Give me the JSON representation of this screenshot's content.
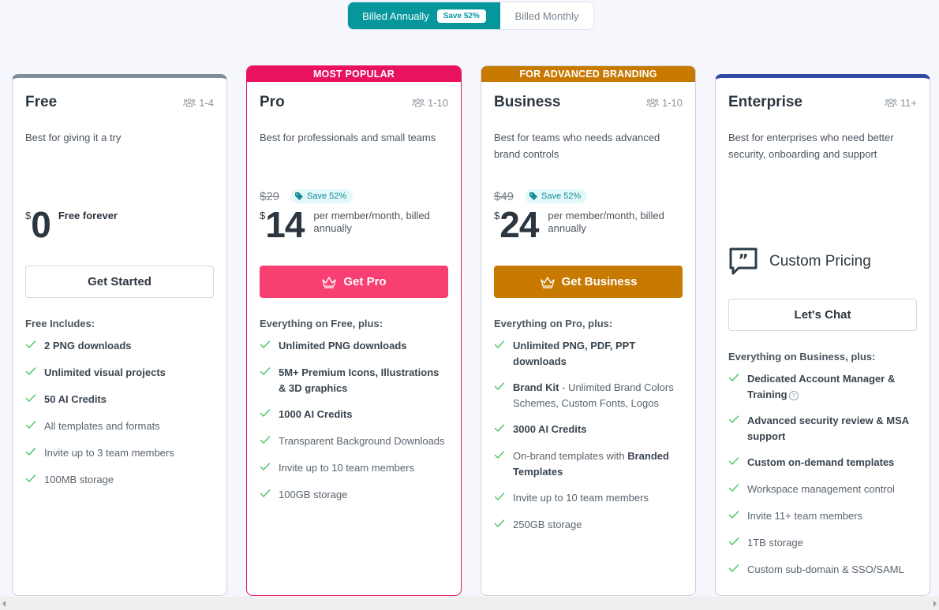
{
  "billing_toggle": {
    "annual_label": "Billed Annually",
    "annual_badge": "Save 52%",
    "monthly_label": "Billed Monthly",
    "active": "annual",
    "accent_color": "#05979c"
  },
  "plans": [
    {
      "name": "Free",
      "seats": "1-4",
      "description": "Best for giving it a try",
      "currency": "$",
      "price": "0",
      "price_note": "Free forever",
      "cta": "Get Started",
      "includes_title": "Free Includes:",
      "top_color": "#7d8f99",
      "features": [
        {
          "text": "2 PNG downloads",
          "bold": true
        },
        {
          "text": "Unlimited visual projects",
          "bold": true
        },
        {
          "text": "50 AI Credits",
          "bold": true
        },
        {
          "text": "All templates and formats",
          "bold": false
        },
        {
          "text": "Invite up to 3 team members",
          "bold": false
        },
        {
          "text": "100MB storage",
          "bold": false
        }
      ]
    },
    {
      "name": "Pro",
      "banner": "MOST POPULAR",
      "banner_color": "#e8125f",
      "seats": "1-10",
      "description": "Best for professionals and small teams",
      "old_price": "$29",
      "save_badge": "Save 52%",
      "currency": "$",
      "price": "14",
      "price_note": "per member/month, billed annually",
      "cta": "Get Pro",
      "cta_color": "#f73f72",
      "includes_title": "Everything on Free, plus:",
      "features": [
        {
          "text": "Unlimited PNG downloads",
          "bold": true
        },
        {
          "text": "5M+ Premium Icons, Illustrations & 3D graphics",
          "bold": true
        },
        {
          "text": "1000 AI Credits",
          "bold": true
        },
        {
          "text": "Transparent Background Downloads",
          "bold": false
        },
        {
          "text": "Invite up to 10 team members",
          "bold": false
        },
        {
          "text": "100GB storage",
          "bold": false
        }
      ]
    },
    {
      "name": "Business",
      "banner": "FOR ADVANCED BRANDING",
      "banner_color": "#c77900",
      "seats": "1-10",
      "description": "Best for teams who needs advanced brand controls",
      "old_price": "$49",
      "save_badge": "Save 52%",
      "currency": "$",
      "price": "24",
      "price_note": "per member/month, billed annually",
      "cta": "Get Business",
      "cta_color": "#c77900",
      "includes_title": "Everything on Pro, plus:",
      "features": [
        {
          "text": "Unlimited PNG, PDF, PPT downloads",
          "bold": true
        },
        {
          "bold_part": "Brand Kit",
          "text": " - Unlimited Brand Colors Schemes, Custom Fonts, Logos"
        },
        {
          "text": "3000 AI Credits",
          "bold": true
        },
        {
          "text": "On-brand templates with ",
          "bold_suffix": "Branded Templates"
        },
        {
          "text": "Invite up to 10 team members",
          "bold": false
        },
        {
          "text": "250GB storage",
          "bold": false
        }
      ]
    },
    {
      "name": "Enterprise",
      "seats": "11+",
      "description": "Best for enterprises who need better security, onboarding and support",
      "custom_pricing": "Custom Pricing",
      "cta": "Let's Chat",
      "includes_title": "Everything on Business, plus:",
      "top_color": "#334aa3",
      "features": [
        {
          "text": "Dedicated Account Manager & Training",
          "bold": true,
          "help": "?"
        },
        {
          "text": "Advanced security review & MSA support",
          "bold": true
        },
        {
          "text": "Custom on-demand templates",
          "bold": true
        },
        {
          "text": "Workspace management control",
          "bold": false
        },
        {
          "text": "Invite 11+ team members",
          "bold": false
        },
        {
          "text": "1TB storage",
          "bold": false
        },
        {
          "text": "Custom sub-domain & SSO/SAML",
          "bold": false
        }
      ]
    }
  ]
}
